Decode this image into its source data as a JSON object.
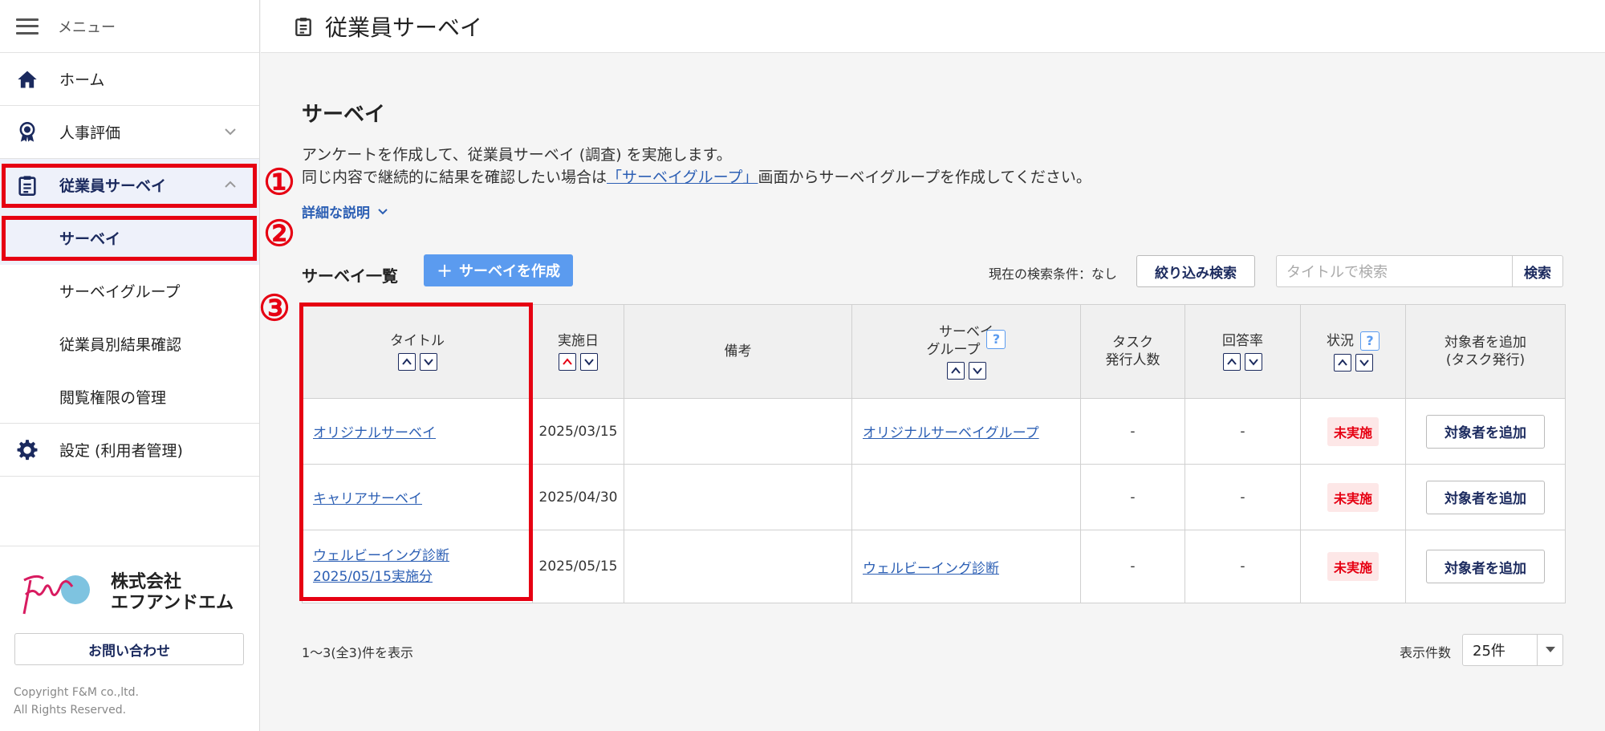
{
  "sidebar": {
    "menu_label": "メニュー",
    "items": [
      {
        "label": "ホーム",
        "icon": "home-icon"
      },
      {
        "label": "人事評価",
        "icon": "award-icon"
      },
      {
        "label": "従業員サーベイ",
        "icon": "clipboard-icon"
      },
      {
        "label": "設定 (利用者管理)",
        "icon": "gear-icon"
      }
    ],
    "sub_items": [
      "サーベイ",
      "サーベイグループ",
      "従業員別結果確認",
      "閲覧権限の管理"
    ],
    "logo_line1": "株式会社",
    "logo_line2": "エフアンドエム",
    "contact_label": "お問い合わせ",
    "copyright_line1": "Copyright F&M co.,ltd.",
    "copyright_line2": "All Rights Reserved."
  },
  "header": {
    "title": "従業員サーベイ"
  },
  "main": {
    "section_title": "サーベイ",
    "desc_line1": "アンケートを作成して、従業員サーベイ (調査) を実施します。",
    "desc_line2_pre": "同じ内容で継続的に結果を確認したい場合は",
    "desc_line2_link": "「サーベイグループ」",
    "desc_line2_post": "画面からサーベイグループを作成してください。",
    "detail_link": "詳細な説明",
    "list_title": "サーベイ一覧",
    "create_button": "サーベイを作成",
    "search_condition": "現在の検索条件：なし",
    "filter_button": "絞り込み検索",
    "search_placeholder": "タイトルで検索",
    "search_button": "検索"
  },
  "table": {
    "headers": {
      "title": "タイトル",
      "date": "実施日",
      "note": "備考",
      "group_line1": "サーベイ",
      "group_line2": "グループ",
      "task_line1": "タスク",
      "task_line2": "発行人数",
      "rate": "回答率",
      "status": "状況",
      "add_line1": "対象者を追加",
      "add_line2": "(タスク発行)"
    },
    "help_mark": "?",
    "rows": [
      {
        "title": "オリジナルサーベイ",
        "title2": "",
        "date": "2025/03/15",
        "note": "",
        "group": "オリジナルサーベイグループ",
        "tasks": "-",
        "rate": "-",
        "status": "未実施",
        "action": "対象者を追加"
      },
      {
        "title": "キャリアサーベイ",
        "title2": "",
        "date": "2025/04/30",
        "note": "",
        "group": "",
        "tasks": "-",
        "rate": "-",
        "status": "未実施",
        "action": "対象者を追加"
      },
      {
        "title": "ウェルビーイング診断",
        "title2": "2025/05/15実施分",
        "date": "2025/05/15",
        "note": "",
        "group": "ウェルビーイング診断",
        "tasks": "-",
        "rate": "-",
        "status": "未実施",
        "action": "対象者を追加"
      }
    ]
  },
  "footer": {
    "count_text": "1〜3(全3)件を表示",
    "per_page_label": "表示件数",
    "per_page_value": "25件"
  },
  "annotations": [
    "①",
    "②",
    "③"
  ],
  "colors": {
    "highlight": "#e60012",
    "accent": "#5b9bef",
    "navy": "#1b2a5e",
    "link": "#2c5fb4"
  }
}
